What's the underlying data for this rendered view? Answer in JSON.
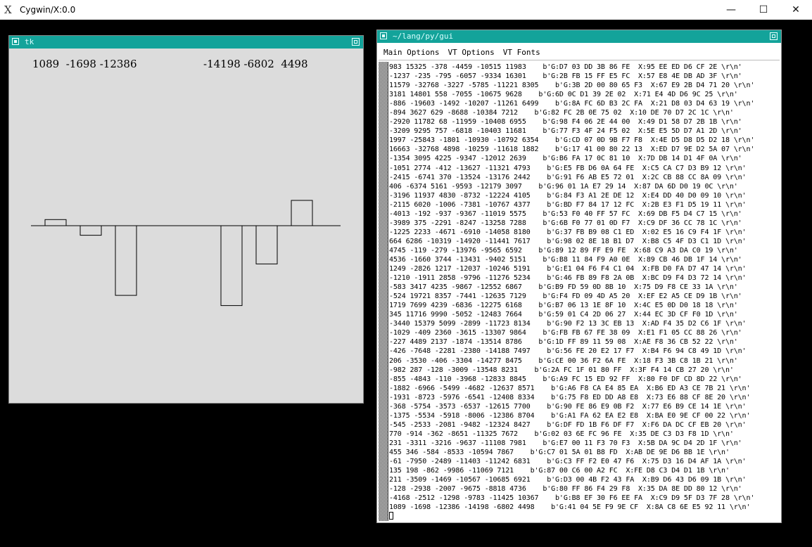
{
  "host": {
    "title": "Cygwin/X:0.0",
    "minimize_glyph": "—",
    "maximize_glyph": "☐",
    "close_glyph": "✕"
  },
  "tk_window": {
    "title": "tk",
    "left_label": "1089  -1698 -12386",
    "right_label": "-14198 -6802  4498"
  },
  "chart_data": {
    "type": "bar",
    "title": "",
    "xlabel": "",
    "ylabel": "",
    "categories": [
      "1089",
      "-1698",
      "-12386",
      "-14198",
      "-6802",
      "4498"
    ],
    "values": [
      1089,
      -1698,
      -12386,
      -14198,
      -6802,
      4498
    ],
    "baseline": 0,
    "ylim": [
      -17000,
      6500
    ],
    "grid": false,
    "legend": "none"
  },
  "xterm": {
    "title": "~/lang/py/gui",
    "menus": [
      "Main Options",
      "VT Options",
      "VT Fonts"
    ],
    "lines": [
      "983 15325 -378 -4459 -10515 11983    b'G:D7 03 DD 3B 86 FE  X:95 EE ED D6 CF 2E \\r\\n'",
      "-1237 -235 -795 -6057 -9334 16301    b'G:2B FB 15 FF E5 FC  X:57 E8 4E DB AD 3F \\r\\n'",
      "11579 -32768 -3227 -5785 -11221 8305    b'G:3B 2D 00 80 65 F3  X:67 E9 2B D4 71 20 \\r\\n'",
      "3181 14801 558 -7055 -10675 9628    b'G:6D 0C D1 39 2E 02  X:71 E4 4D D6 9C 25 \\r\\n'",
      "-886 -19603 -1492 -10207 -11261 6499    b'G:8A FC 6D B3 2C FA  X:21 D8 03 D4 63 19 \\r\\n'",
      "-894 3627 629 -8688 -10384 7212    b'G:82 FC 2B 0E 75 02  X:10 DE 70 D7 2C 1C \\r\\n'",
      "-2920 11782 68 -11959 -10408 6955    b'G:98 F4 06 2E 44 00  X:49 D1 58 D7 2B 1B \\r\\n'",
      "-3209 9295 757 -6818 -10403 11681    b'G:77 F3 4F 24 F5 02  X:5E E5 5D D7 A1 2D \\r\\n'",
      "1997 -25843 -1801 -10930 -10792 6354    b'G:CD 07 0D 9B F7 F8  X:4E D5 D8 D5 D2 18 \\r\\n'",
      "16663 -32768 4898 -10259 -11618 1882    b'G:17 41 00 80 22 13  X:ED D7 9E D2 5A 07 \\r\\n'",
      "-1354 3095 4225 -9347 -12012 2639    b'G:B6 FA 17 0C 81 10  X:7D DB 14 D1 4F 0A \\r\\n'",
      "-1051 2774 -412 -13627 -11321 4793    b'G:E5 FB D6 0A 64 FE  X:C5 CA C7 D3 B9 12 \\r\\n'",
      "-2415 -6741 370 -13524 -13176 2442    b'G:91 F6 AB E5 72 01  X:2C CB 88 CC 8A 09 \\r\\n'",
      "406 -6374 5161 -9593 -12179 3097    b'G:96 01 1A E7 29 14  X:87 DA 6D D0 19 0C \\r\\n'",
      "-3196 11937 4830 -8732 -12224 4105    b'G:84 F3 A1 2E DE 12  X:E4 DD 40 D0 09 10 \\r\\n'",
      "-2115 6020 -1006 -7381 -10767 4377    b'G:BD F7 84 17 12 FC  X:2B E3 F1 D5 19 11 \\r\\n'",
      "-4013 -192 -937 -9367 -11019 5575    b'G:53 F0 40 FF 57 FC  X:69 DB F5 D4 C7 15 \\r\\n'",
      "-3989 375 -2291 -8247 -13258 7288    b'G:6B F0 77 01 0D F7  X:C9 DF 36 CC 78 1C \\r\\n'",
      "-1225 2233 -4671 -6910 -14058 8180    b'G:37 FB B9 08 C1 ED  X:02 E5 16 C9 F4 1F \\r\\n'",
      "664 6286 -10319 -14920 -11441 7617    b'G:98 02 8E 18 B1 D7  X:B8 C5 4F D3 C1 1D \\r\\n'",
      "4745 -119 -279 -13976 -9565 6592    b'G:89 12 89 FF E9 FE  X:68 C9 A3 DA C0 19 \\r\\n'",
      "4536 -1660 3744 -13431 -9402 5151    b'G:B8 11 84 F9 A0 0E  X:89 CB 46 DB 1F 14 \\r\\n'",
      "1249 -2826 1217 -12037 -10246 5191    b'G:E1 04 F6 F4 C1 04  X:FB D0 FA D7 47 14 \\r\\n'",
      "-1210 -1911 2858 -9796 -11276 5234    b'G:46 FB 89 F8 2A 0B  X:BC D9 F4 D3 72 14 \\r\\n'",
      "-583 3417 4235 -9867 -12552 6867    b'G:B9 FD 59 0D 8B 10  X:75 D9 F8 CE 33 1A \\r\\n'",
      "-524 19721 8357 -7441 -12635 7129    b'G:F4 FD 09 4D A5 20  X:EF E2 A5 CE D9 1B \\r\\n'",
      "1719 7699 4239 -6836 -12275 6168    b'G:B7 06 13 1E 8F 10  X:4C E5 0D D0 18 18 \\r\\n'",
      "345 11716 9990 -5052 -12483 7664    b'G:59 01 C4 2D 06 27  X:44 EC 3D CF F0 1D \\r\\n'",
      "-3440 15379 5099 -2899 -11723 8134    b'G:90 F2 13 3C EB 13  X:AD F4 35 D2 C6 1F \\r\\n'",
      "-1029 -409 2360 -3615 -13307 9864    b'G:FB FB 67 FE 38 09  X:E1 F1 05 CC 88 26 \\r\\n'",
      "-227 4489 2137 -1874 -13514 8786    b'G:1D FF 89 11 59 08  X:AE F8 36 CB 52 22 \\r\\n'",
      "-426 -7648 -2281 -2380 -14188 7497    b'G:56 FE 20 E2 17 F7  X:B4 F6 94 C8 49 1D \\r\\n'",
      "206 -3530 -406 -3304 -14277 8475    b'G:CE 00 36 F2 6A FE  X:18 F3 3B C8 1B 21 \\r\\n'",
      "-982 287 -128 -3009 -13548 8231    b'G:2A FC 1F 01 80 FF  X:3F F4 14 CB 27 20 \\r\\n'",
      "-855 -4843 -110 -3968 -12833 8845    b'G:A9 FC 15 ED 92 FF  X:80 F0 DF CD 8D 22 \\r\\n'",
      "-1882 -6966 -5499 -4682 -12637 8571    b'G:A6 F8 CA E4 85 EA  X:B6 ED A3 CE 7B 21 \\r\\n'",
      "-1931 -8723 -5976 -6541 -12408 8334    b'G:75 F8 ED DD A8 E8  X:73 E6 88 CF 8E 20 \\r\\n'",
      "-368 -5754 -3573 -6537 -12615 7700    b'G:90 FE 86 E9 0B F2  X:77 E6 B9 CE 14 1E \\r\\n'",
      "-1375 -5534 -5918 -8006 -12386 8704    b'G:A1 FA 62 EA E2 E8  X:BA E0 9E CF 00 22 \\r\\n'",
      "-545 -2533 -2081 -9482 -12324 8427    b'G:DF FD 1B F6 DF F7  X:F6 DA DC CF EB 20 \\r\\n'",
      "770 -914 -362 -8651 -11325 7672    b'G:02 03 6E FC 96 FE  X:35 DE C3 D3 F8 1D \\r\\n'",
      "231 -3311 -3216 -9637 -11108 7981    b'G:E7 00 11 F3 70 F3  X:5B DA 9C D4 2D 1F \\r\\n'",
      "455 346 -584 -8533 -10594 7867    b'G:C7 01 5A 01 B8 FD  X:AB DE 9E D6 BB 1E \\r\\n'",
      "-61 -7950 -2489 -11403 -11242 6831    b'G:C3 FF F2 E0 47 F6  X:75 D3 16 D4 AF 1A \\r\\n'",
      "135 198 -862 -9986 -11069 7121    b'G:87 00 C6 00 A2 FC  X:FE D8 C3 D4 D1 1B \\r\\n'",
      "211 -3509 -1469 -10567 -10685 6921    b'G:D3 00 4B F2 43 FA  X:B9 D6 43 D6 09 1B \\r\\n'",
      "-128 -2938 -2007 -9675 -8818 4736    b'G:80 FF 86 F4 29 F8  X:35 DA 8E DD 80 12 \\r\\n'",
      "-4168 -2512 -1298 -9783 -11425 10367    b'G:B8 EF 30 F6 EE FA  X:C9 D9 5F D3 7F 28 \\r\\n'",
      "1089 -1698 -12386 -14198 -6802 4498    b'G:41 04 5E F9 9E CF  X:8A C8 6E E5 92 11 \\r\\n'"
    ]
  }
}
